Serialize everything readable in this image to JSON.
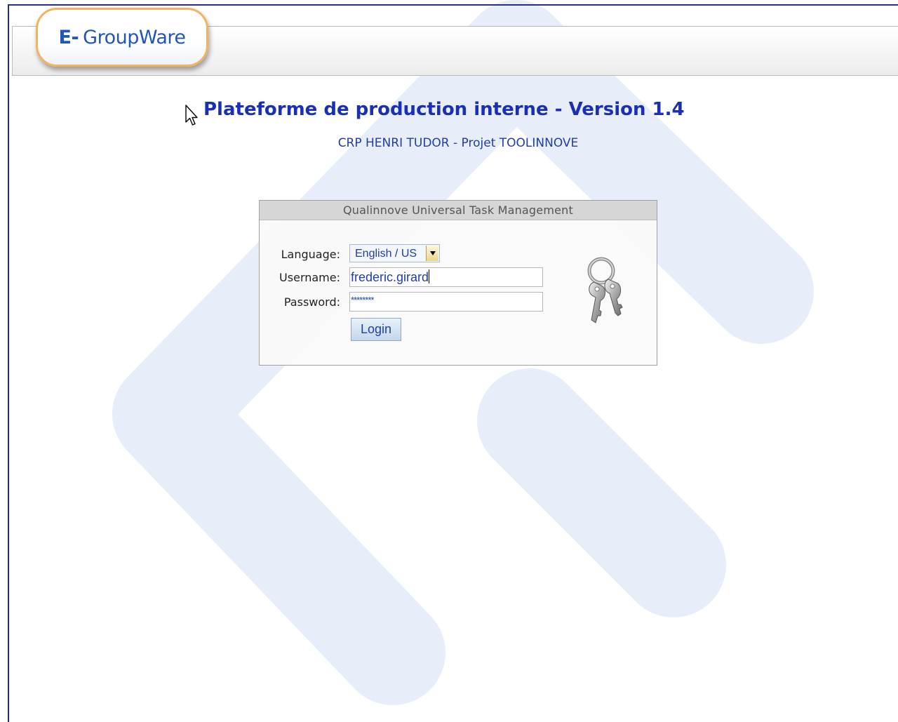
{
  "header": {
    "logo_icon": "E-",
    "logo_text": "GroupWare"
  },
  "page": {
    "title": "Plateforme de production interne - Version 1.4",
    "subtitle": "CRP HENRI TUDOR - Projet TOOLINNOVE"
  },
  "login_box": {
    "title": "Qualinnove Universal Task Management",
    "language_label": "Language:",
    "language_value": "English / US",
    "username_label": "Username:",
    "username_value": "frederic.girard",
    "password_label": "Password:",
    "password_value": "********",
    "login_label": "Login"
  },
  "icons": {
    "keys": "keys-icon",
    "cursor": "mouse-cursor-icon",
    "dropdown": "chevron-down-icon"
  },
  "colors": {
    "title_blue": "#1a2fb8",
    "text_blue": "#1f3ea6",
    "logo_border": "#f3b25c",
    "watermark": "#e6ecf8",
    "frame": "#2a2a96"
  }
}
